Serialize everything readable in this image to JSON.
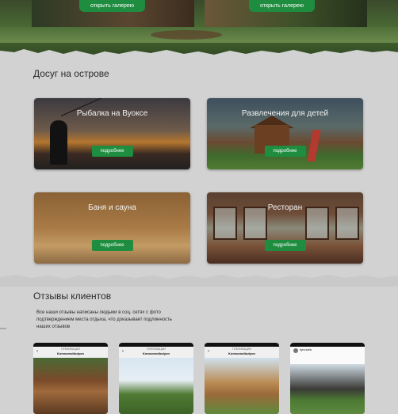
{
  "gallery": {
    "buttons": [
      "открыть галерею",
      "открыть галерею"
    ]
  },
  "leisure": {
    "heading": "Досуг на острове",
    "cards": [
      {
        "title": "Рыбалка на Вуоксе",
        "button": "подробнее"
      },
      {
        "title": "Развлечения для детей",
        "button": "подробнее"
      },
      {
        "title": "Баня и сауна",
        "button": "подробнее"
      },
      {
        "title": "Ресторан",
        "button": "подробнее"
      }
    ]
  },
  "reviews": {
    "heading": "Отзывы клиентов",
    "text": "Все наши отзывы написаны людьми в соц. сетях с фото подтверждением места отдыха, что доказывает подлинность наших отзывов",
    "phones": [
      {
        "subtitle": "ПУБЛИКАЦИИ",
        "title": "Komsomolbutyon"
      },
      {
        "subtitle": "ПУБЛИКАЦИИ",
        "title": "Komsomolbutyon"
      },
      {
        "subtitle": "ПУБЛИКАЦИИ",
        "title": "Komsomolbutyon"
      },
      {
        "user": "kyra.korts"
      }
    ]
  },
  "colors": {
    "accent": "#1f8d3f",
    "background": "#d2d2d2"
  }
}
